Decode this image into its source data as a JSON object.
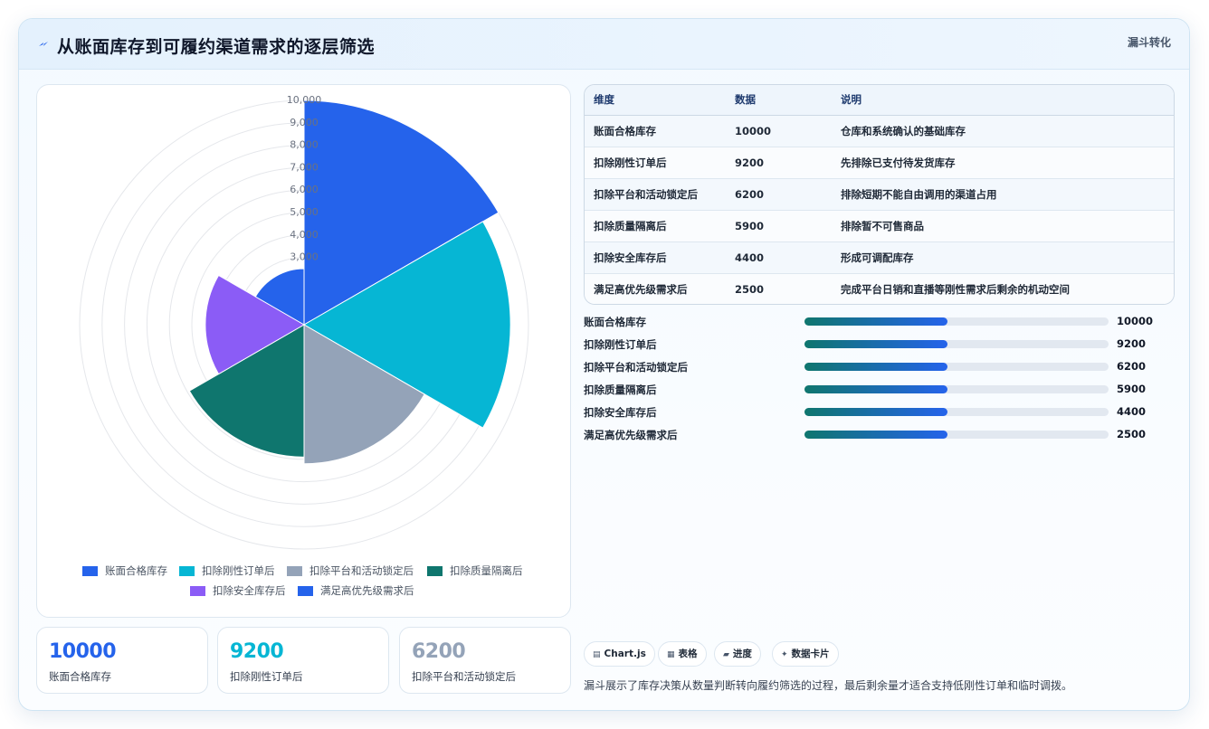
{
  "header": {
    "title": "从账面库存到可履约渠道需求的逐层筛选",
    "tag": "漏斗转化"
  },
  "colors": {
    "accent_primary": "#2563eb",
    "accent_teal": "#0f766e",
    "accent_cyan": "#06b6d4",
    "accent_slate": "#94a3b8",
    "accent_purple": "#8b5cf6"
  },
  "chart_data": {
    "type": "polarArea",
    "categories": [
      "账面合格库存",
      "扣除刚性订单后",
      "扣除平台和活动锁定后",
      "扣除质量隔离后",
      "扣除安全库存后",
      "满足高优先级需求后"
    ],
    "values": [
      10000,
      9200,
      6200,
      5900,
      4400,
      2500
    ],
    "colors": [
      "#2563eb",
      "#06b6d4",
      "#94a3b8",
      "#0f766e",
      "#8b5cf6",
      "#2563eb"
    ],
    "r_ticks": [
      "3,000",
      "4,000",
      "5,000",
      "6,000",
      "7,000",
      "8,000",
      "9,000",
      "10,000"
    ],
    "r_tick_values": [
      3000,
      4000,
      5000,
      6000,
      7000,
      8000,
      9000,
      10000
    ],
    "r_range": [
      0,
      10000
    ],
    "grid": true,
    "legend_position": "bottom"
  },
  "table": {
    "headers": [
      "维度",
      "数据",
      "说明"
    ],
    "rows": [
      [
        "账面合格库存",
        "10000",
        "仓库和系统确认的基础库存"
      ],
      [
        "扣除刚性订单后",
        "9200",
        "先排除已支付待发货库存"
      ],
      [
        "扣除平台和活动锁定后",
        "6200",
        "排除短期不能自由调用的渠道占用"
      ],
      [
        "扣除质量隔离后",
        "5900",
        "排除暂不可售商品"
      ],
      [
        "扣除安全库存后",
        "4400",
        "形成可调配库存"
      ],
      [
        "满足高优先级需求后",
        "2500",
        "完成平台日销和直播等刚性需求后剩余的机动空间"
      ]
    ]
  },
  "progress": [
    {
      "label": "账面合格库存",
      "value": "10000",
      "fraction": 0.47
    },
    {
      "label": "扣除刚性订单后",
      "value": "9200",
      "fraction": 0.47
    },
    {
      "label": "扣除平台和活动锁定后",
      "value": "6200",
      "fraction": 0.47
    },
    {
      "label": "扣除质量隔离后",
      "value": "5900",
      "fraction": 0.47
    },
    {
      "label": "扣除安全库存后",
      "value": "4400",
      "fraction": 0.47
    },
    {
      "label": "满足高优先级需求后",
      "value": "2500",
      "fraction": 0.47
    }
  ],
  "stats": [
    {
      "value": "10000",
      "label": "账面合格库存",
      "color": "#2563eb"
    },
    {
      "value": "9200",
      "label": "扣除刚性订单后",
      "color": "#06b6d4"
    },
    {
      "value": "6200",
      "label": "扣除平台和活动锁定后",
      "color": "#94a3b8"
    }
  ],
  "pills": [
    {
      "icon": "chart-icon",
      "glyph": "▤",
      "label": "Chart.js"
    },
    {
      "icon": "table-icon",
      "glyph": "▦",
      "label": "表格"
    },
    {
      "icon": "progress-icon",
      "glyph": "▰",
      "label": "进度"
    },
    {
      "icon": "sparkle-icon",
      "glyph": "✦",
      "label": "数据卡片"
    }
  ],
  "summary": "漏斗展示了库存决策从数量判断转向履约筛选的过程，最后剩余量才适合支持低刚性订单和临时调拨。"
}
